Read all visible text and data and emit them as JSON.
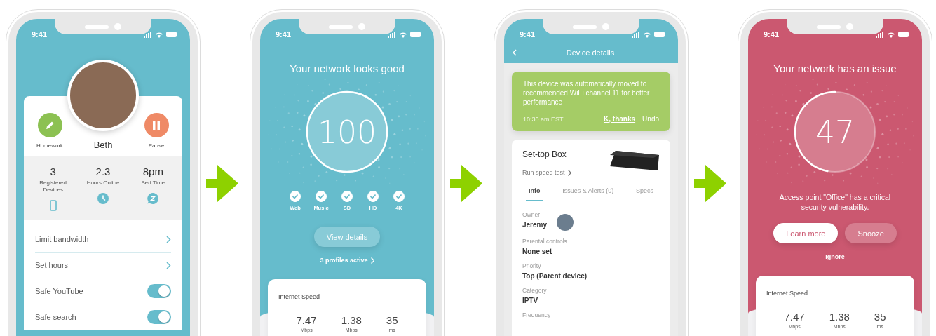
{
  "phones": [
    {
      "kind": "profile",
      "color": "#66bccc",
      "time": "9:41",
      "name": "Beth",
      "actions": [
        {
          "label": "Homework",
          "kind": "edit",
          "color": "#8cc152"
        },
        {
          "label": "Pause",
          "kind": "pause",
          "color": "#ef8a66"
        }
      ],
      "stats": [
        {
          "value": "3",
          "label": "Registered Devices",
          "kind": "device"
        },
        {
          "value": "2.3",
          "label": "Hours Online",
          "kind": "clock"
        },
        {
          "value": "8pm",
          "label": "Bed Time",
          "kind": "sleep"
        }
      ],
      "settings": [
        {
          "label": "Limit bandwidth",
          "kind": "link"
        },
        {
          "label": "Set hours",
          "kind": "link"
        },
        {
          "label": "Safe YouTube",
          "kind": "toggle",
          "on": true
        },
        {
          "label": "Safe search",
          "kind": "toggle",
          "on": true
        }
      ]
    },
    {
      "kind": "score",
      "color": "#66bccc",
      "time": "9:41",
      "title": "Your network looks good",
      "score": "100",
      "level": 1,
      "checks": [
        {
          "label": "Web",
          "checked": true
        },
        {
          "label": "Music",
          "checked": true
        },
        {
          "label": "SD",
          "checked": true
        },
        {
          "label": "HD",
          "checked": true
        },
        {
          "label": "4K",
          "checked": true
        }
      ],
      "buttons": [
        {
          "label": "View details",
          "kind": "soft"
        }
      ],
      "link": "3 profiles active",
      "speed": {
        "title": "Internet Speed",
        "metrics": [
          {
            "value": "7.47",
            "unit": "Mbps"
          },
          {
            "value": "1.38",
            "unit": "Mbps"
          },
          {
            "value": "35",
            "unit": "ms"
          }
        ]
      }
    },
    {
      "kind": "device",
      "color": "#66bccc",
      "time": "9:41",
      "title": "Device details",
      "notice": {
        "text": "This device was automatically moved to recommended WiFi channel 11 for better performance",
        "time": "10:30 am EST",
        "actions": [
          {
            "label": "K, thanks",
            "underlined": true
          },
          {
            "label": "Undo",
            "underlined": false
          }
        ]
      },
      "name": "Set-top Box",
      "link": "Run speed test",
      "tabs": [
        {
          "label": "Info",
          "selected": true
        },
        {
          "label": "Issues & Alerts (0)",
          "selected": false
        },
        {
          "label": "Specs",
          "selected": false
        }
      ],
      "fields": [
        {
          "label": "Owner",
          "value": "Jeremy",
          "kind": "person"
        },
        {
          "label": "Parental controls",
          "value": "None set",
          "kind": "text"
        },
        {
          "label": "Priority",
          "value": "Top (Parent device)",
          "kind": "text"
        },
        {
          "label": "Category",
          "value": "IPTV",
          "kind": "text"
        },
        {
          "label": "Frequency",
          "kind": "text"
        }
      ]
    },
    {
      "kind": "score",
      "color": "#cb5870",
      "time": "9:41",
      "title": "Your network has an issue",
      "score": "47",
      "level": 0.47,
      "message": "Access point \"Office\" has a critical security vulnerability.",
      "buttons": [
        {
          "label": "Learn more",
          "kind": "solid"
        },
        {
          "label": "Snooze",
          "kind": "soft"
        }
      ],
      "link": "Ignore",
      "speed": {
        "title": "Internet Speed",
        "metrics": [
          {
            "value": "7.47",
            "unit": "Mbps"
          },
          {
            "value": "1.38",
            "unit": "Mbps"
          },
          {
            "value": "35",
            "unit": "ms"
          }
        ]
      }
    }
  ]
}
